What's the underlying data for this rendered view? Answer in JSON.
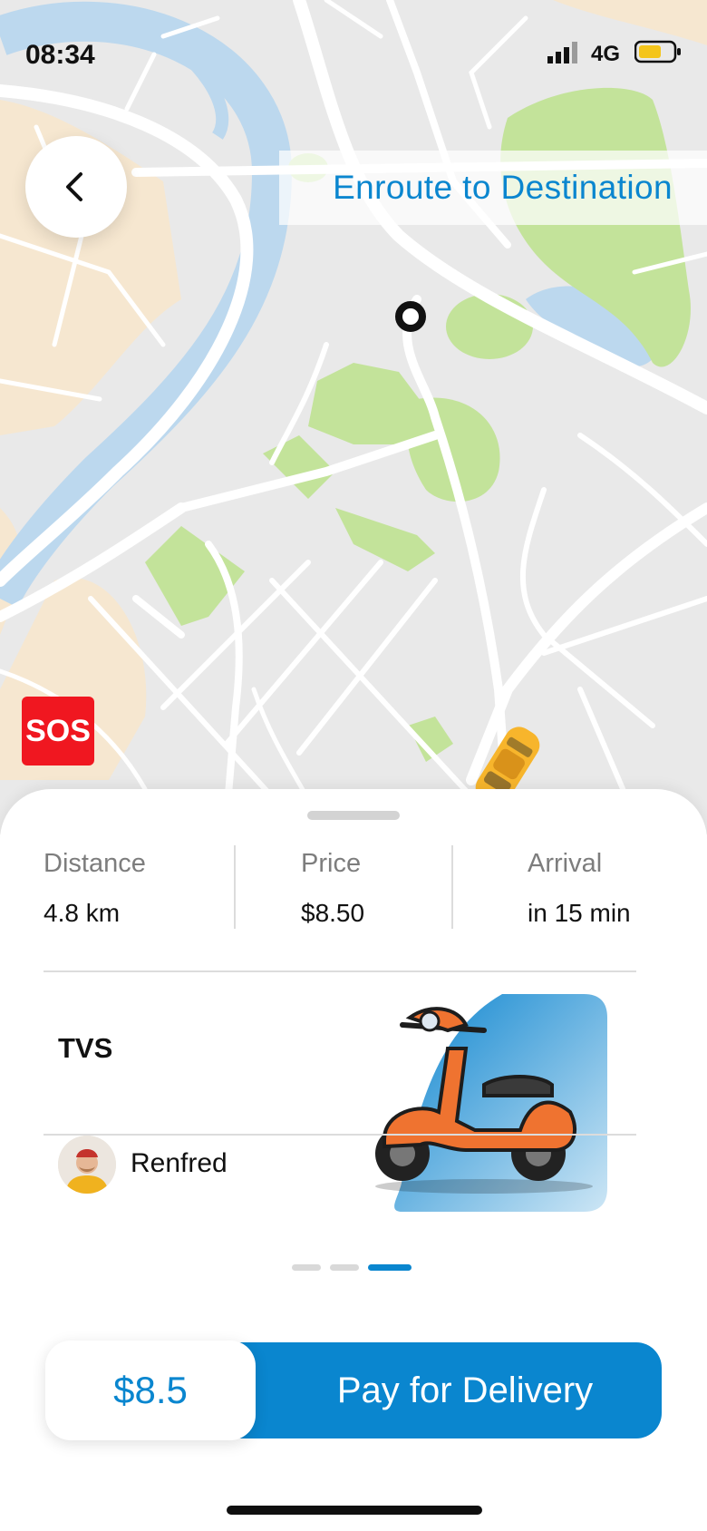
{
  "status_bar": {
    "time": "08:34",
    "network": "4G",
    "battery_color": "#f4c51b"
  },
  "header": {
    "title": "Enroute to Destination"
  },
  "sos": {
    "label": "SOS"
  },
  "trip": {
    "stats": [
      {
        "label": "Distance",
        "value": "4.8 km"
      },
      {
        "label": "Price",
        "value": "$8.50"
      },
      {
        "label": "Arrival",
        "value": "in 15 min"
      }
    ]
  },
  "vehicle": {
    "name": "TVS",
    "driver_name": "Renfred"
  },
  "pager": {
    "count": 3,
    "active_index": 2
  },
  "payment": {
    "amount": "$8.5",
    "button_label": "Pay for Delivery"
  },
  "colors": {
    "accent": "#0a86cf",
    "sos": "#f01720",
    "map_bg": "#e9e9e9",
    "park": "#c3e39a",
    "water": "#bcd8ee",
    "sand": "#f6e7d0"
  }
}
